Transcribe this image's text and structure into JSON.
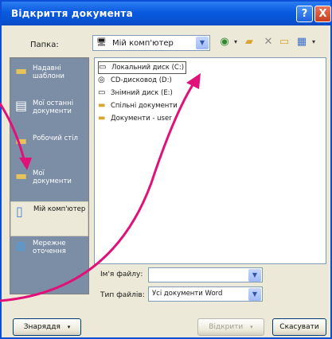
{
  "window": {
    "title": "Відкриття документа"
  },
  "titlebar_buttons": {
    "help": "?",
    "close": "X"
  },
  "look_in": {
    "label": "Папка:",
    "value": "Мій комп'ютер"
  },
  "places": [
    {
      "icon": "history-icon",
      "label": "Надавні шаблони"
    },
    {
      "icon": "my-documents-icon",
      "label": "Мої останні документи"
    },
    {
      "icon": "desktop-icon",
      "label": "Робочий стіл"
    },
    {
      "icon": "my-documents-folder-icon",
      "label": "Мої документи"
    },
    {
      "icon": "my-computer-icon",
      "label": "Мій комп'ютер"
    },
    {
      "icon": "network-icon",
      "label": "Мережне оточення"
    }
  ],
  "selected_place": 4,
  "files": [
    {
      "icon": "local-disk-icon",
      "name": "Локальний диск (C:)"
    },
    {
      "icon": "cd-drive-icon",
      "name": "CD-дисковод (D:)"
    },
    {
      "icon": "removable-disk-icon",
      "name": "Знімний диск (E:)"
    },
    {
      "icon": "folder-icon",
      "name": "Спільні документи"
    },
    {
      "icon": "folder-icon",
      "name": "Документи - user"
    }
  ],
  "file_name": {
    "label": "Ім'я файлу:",
    "value": ""
  },
  "file_type": {
    "label": "Тип файлів:",
    "value": "Усі документи Word"
  },
  "buttons": {
    "tools": "Знаряддя",
    "open": "Відкрити",
    "cancel": "Скасувати"
  },
  "colors": {
    "titlebar": "#0a5ae0",
    "places_bg": "#7b8ea6",
    "annotation_arrow": "#e0127a"
  }
}
